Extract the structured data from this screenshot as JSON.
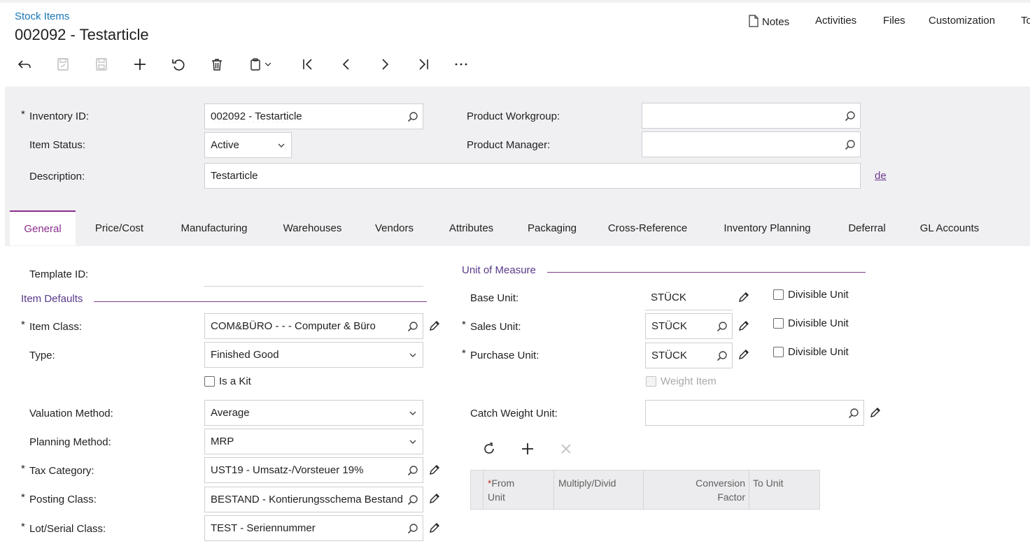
{
  "breadcrumb": "Stock Items",
  "page_title": "002092 - Testarticle",
  "header_links": [
    "Notes",
    "Activities",
    "Files",
    "Customization",
    "To"
  ],
  "form": {
    "inventory_id": {
      "label": "Inventory ID:",
      "value": "002092 - Testarticle"
    },
    "item_status": {
      "label": "Item Status:",
      "value": "Active"
    },
    "description": {
      "label": "Description:",
      "value": "Testarticle",
      "lang": "de"
    },
    "product_workgroup": {
      "label": "Product Workgroup:",
      "value": ""
    },
    "product_manager": {
      "label": "Product Manager:",
      "value": ""
    }
  },
  "tabs": [
    "General",
    "Price/Cost",
    "Manufacturing",
    "Warehouses",
    "Vendors",
    "Attributes",
    "Packaging",
    "Cross-Reference",
    "Inventory Planning",
    "Deferral",
    "GL Accounts"
  ],
  "general": {
    "template_id": {
      "label": "Template ID:",
      "value": ""
    },
    "item_defaults_title": "Item Defaults",
    "item_class": {
      "label": "Item Class:",
      "value": "COM&BÜRO  -         - - Computer & Büro"
    },
    "type": {
      "label": "Type:",
      "value": "Finished Good"
    },
    "is_a_kit": "Is a Kit",
    "valuation_method": {
      "label": "Valuation Method:",
      "value": "Average"
    },
    "planning_method": {
      "label": "Planning Method:",
      "value": "MRP"
    },
    "tax_category": {
      "label": "Tax Category:",
      "value": "UST19 - Umsatz-/Vorsteuer 19%"
    },
    "posting_class": {
      "label": "Posting Class:",
      "value": "BESTAND - Kontierungsschema Bestand"
    },
    "lot_serial_class": {
      "label": "Lot/Serial Class:",
      "value": "TEST - Seriennummer"
    }
  },
  "uom": {
    "title": "Unit of Measure",
    "base_unit": {
      "label": "Base Unit:",
      "value": "STÜCK"
    },
    "sales_unit": {
      "label": "Sales Unit:",
      "value": "STÜCK"
    },
    "purchase_unit": {
      "label": "Purchase Unit:",
      "value": "STÜCK"
    },
    "divisible_unit": "Divisible Unit",
    "weight_item": "Weight Item",
    "catch_weight_unit": {
      "label": "Catch Weight Unit:",
      "value": ""
    },
    "grid_columns": {
      "from_unit_1": "From",
      "from_unit_2": "Unit",
      "multiply": "Multiply/Divid",
      "conv_1": "Conversion",
      "conv_2": "Factor",
      "to_unit": "To Unit"
    }
  },
  "required_mark": "*",
  "colors": {
    "accent": "#8a2e8c",
    "link": "#1b77b8",
    "panel": "#f0f0f2"
  }
}
